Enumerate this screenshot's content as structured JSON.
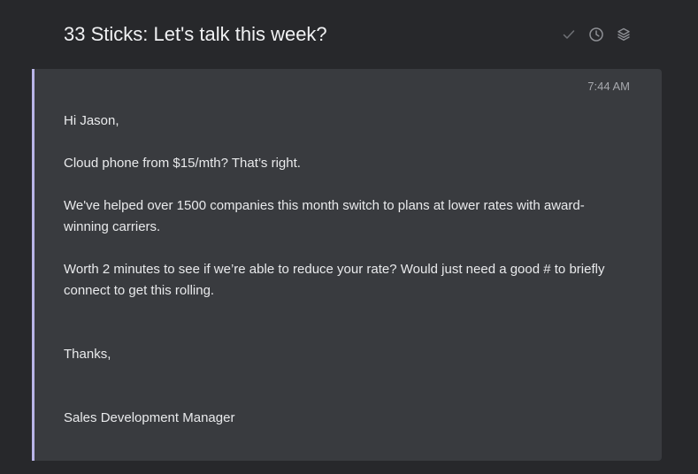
{
  "header": {
    "subject": "33 Sticks: Let's talk this week?",
    "actions": [
      {
        "name": "check-icon"
      },
      {
        "name": "clock-icon"
      },
      {
        "name": "layers-icon"
      }
    ]
  },
  "message": {
    "timestamp": "7:44 AM",
    "greeting": "Hi Jason,",
    "paragraph_1": "Cloud phone from $15/mth? That’s right.",
    "paragraph_2": "We've helped over 1500 companies this month switch to plans at lower rates with award-winning carriers.",
    "paragraph_3": "Worth 2 minutes to see if we’re able to reduce your rate? Would just need a good # to briefly connect to get this rolling.",
    "signoff": "Thanks,",
    "signature": "Sales Development Manager"
  },
  "colors": {
    "background": "#27282b",
    "card": "#393b3f",
    "accent": "#b9b5e8",
    "icon": "#8e9095"
  }
}
